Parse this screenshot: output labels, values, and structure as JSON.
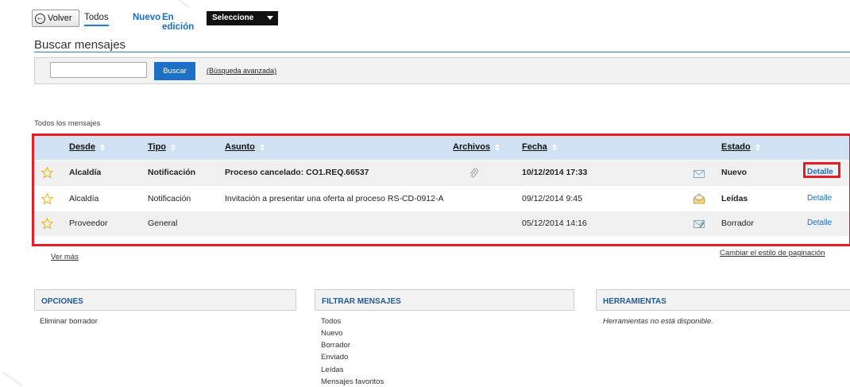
{
  "toolbar": {
    "back_label": "Volver",
    "tabs": [
      {
        "label": "Todos"
      },
      {
        "label": "Nuevo"
      },
      {
        "label": "En edición"
      }
    ],
    "select_label": "Seleccione"
  },
  "search": {
    "title": "Buscar mensajes",
    "input_value": "",
    "button_label": "Buscar",
    "advanced_link": "(Búsqueda avanzada)"
  },
  "messages": {
    "section_label": "Todos los mensajes",
    "columns": {
      "from": "Desde",
      "type": "Tipo",
      "subject": "Asunto",
      "files": "Archivos",
      "date": "Fecha",
      "status": "Estado"
    },
    "rows": [
      {
        "from": "Alcaldía",
        "type": "Notificación",
        "subject": "Proceso cancelado: CO1.REQ.66537",
        "has_file": true,
        "date": "10/12/2014 17:33",
        "status_icon": "envelope-closed-icon",
        "status": "Nuevo",
        "detail": "Detalle",
        "bold": true
      },
      {
        "from": "Alcaldía",
        "type": "Notificación",
        "subject": "Invitación a presentar una oferta al proceso RS-CD-0912-A",
        "has_file": false,
        "date": "09/12/2014 9:45",
        "status_icon": "envelope-open-icon",
        "status": "Leídas",
        "detail": "Detalle",
        "bold": false
      },
      {
        "from": "Proveedor",
        "type": "General",
        "subject": "",
        "has_file": false,
        "date": "05/12/2014 14:16",
        "status_icon": "envelope-draft-icon",
        "status": "Borrador",
        "detail": "Detalle",
        "bold": false
      }
    ],
    "ver_mas": "Ver más",
    "change_pagination": "Cambiar el estilo de paginación"
  },
  "panels": {
    "options": {
      "title": "OPCIONES",
      "items": [
        "Eliminar borrador"
      ]
    },
    "filter": {
      "title": "FILTRAR MENSAJES",
      "items": [
        "Todos",
        "Nuevo",
        "Borrador",
        "Enviado",
        "Leídas",
        "Mensajes favoritos"
      ]
    },
    "tools": {
      "title": "HERRAMIENTAS",
      "note": "Herramientas no está disponible."
    }
  },
  "colors": {
    "accent": "#1c70c8",
    "link": "#1a6fbf",
    "header_row": "#cfe1f2",
    "highlight": "#e41e26",
    "panel_title": "#1d5a96"
  }
}
